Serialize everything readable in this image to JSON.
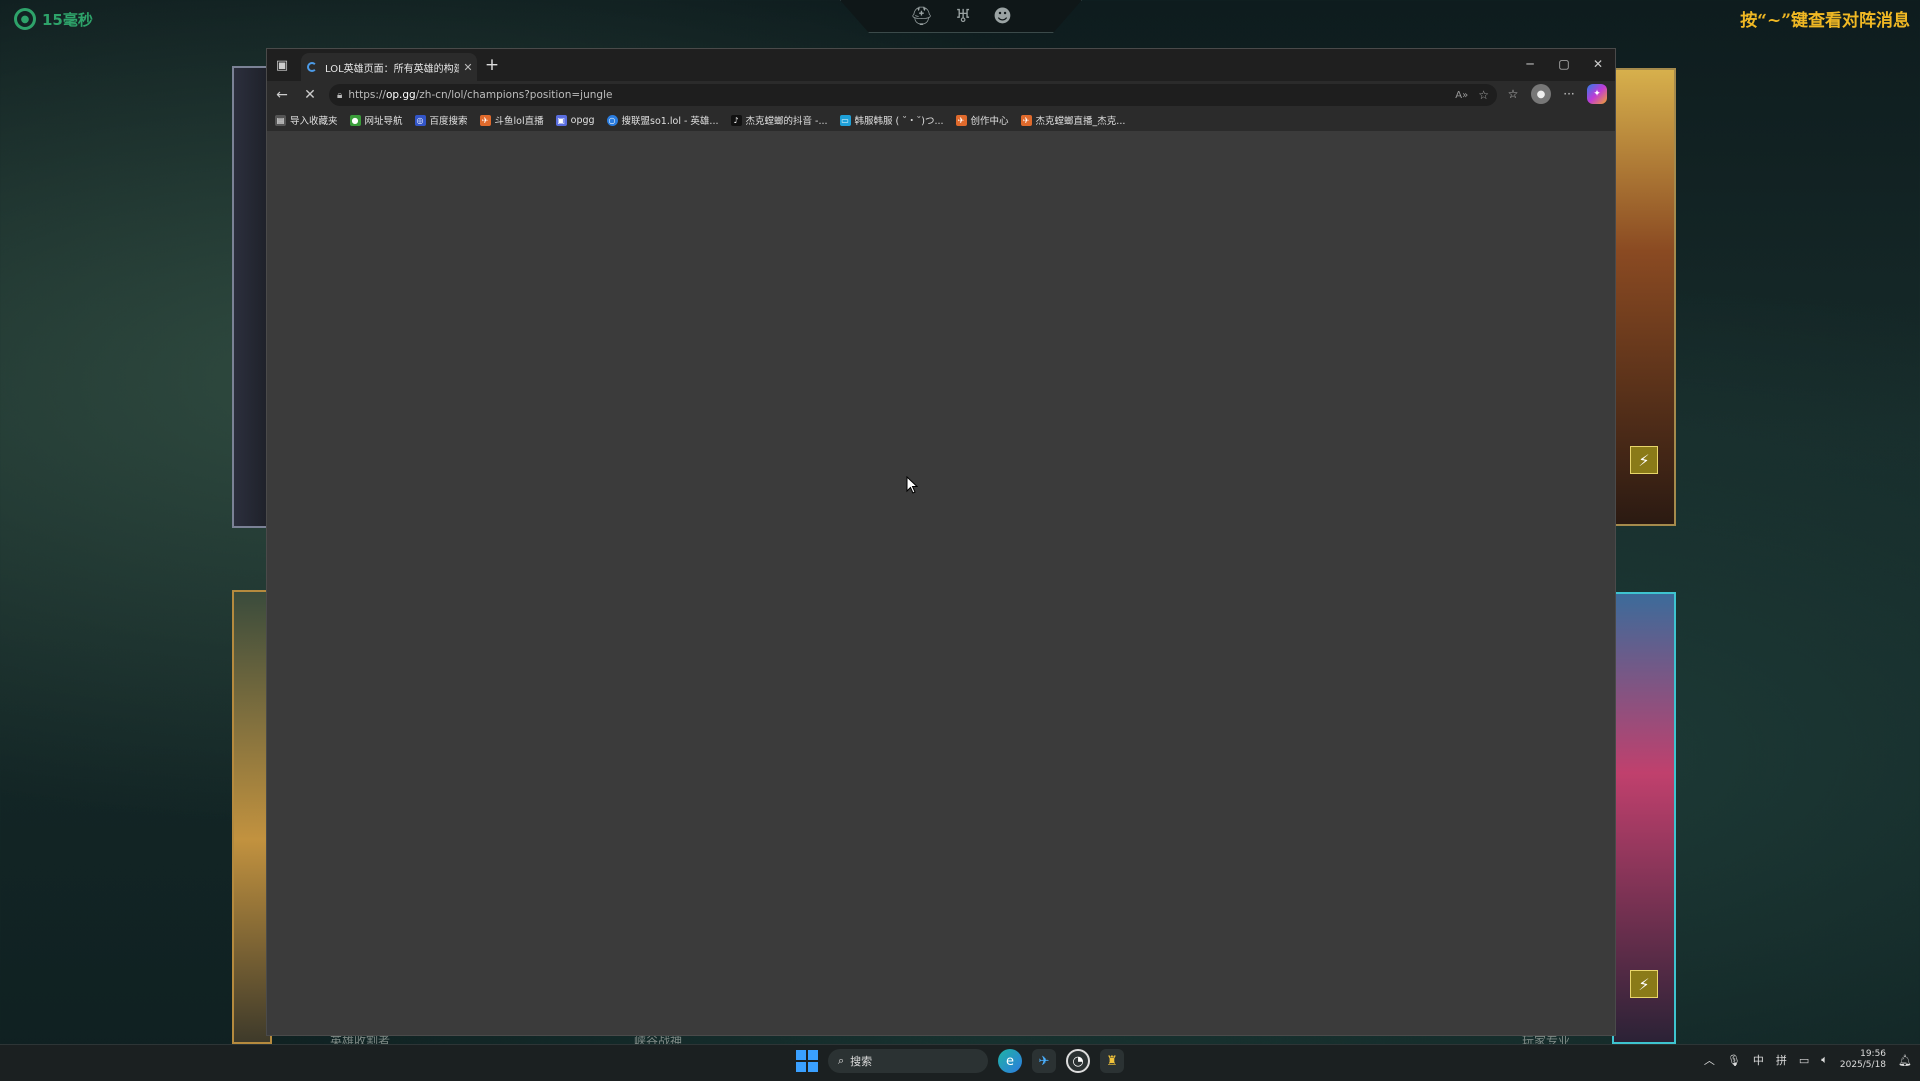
{
  "overlay": {
    "ping_text": "15毫秒",
    "hint_text": "按“~”键查看对阵消息",
    "bottom_labels": [
      "英雄收割者",
      "峡谷战神",
      "玩家专业"
    ]
  },
  "browser": {
    "tab_title": "LOL英雄页面：所有英雄的构建、",
    "tab_close": "✕",
    "new_tab": "+",
    "url_prefix": "https://",
    "url_host": "op.gg",
    "url_path": "/zh-cn/lol/champions?position=jungle",
    "bookmarks": [
      {
        "label": "导入收藏夹",
        "color": "#555"
      },
      {
        "label": "网址导航",
        "color": "#3a9d3a"
      },
      {
        "label": "百度搜索",
        "color": "#3255c8"
      },
      {
        "label": "斗鱼lol直播",
        "color": "#e06a2c"
      },
      {
        "label": "opgg",
        "color": "#5a6ee0"
      },
      {
        "label": "搜联盟so1.lol - 英雄...",
        "color": "#2a7de0"
      },
      {
        "label": "杰克螳螂的抖音 -...",
        "color": "#111"
      },
      {
        "label": "韩服韩服 ( ˘・˘)つ...",
        "color": "#1ea0d8"
      },
      {
        "label": "创作中心",
        "color": "#e06a2c"
      },
      {
        "label": "杰克螳螂直播_杰克...",
        "color": "#e06a2c"
      }
    ]
  },
  "taskbar": {
    "search_placeholder": "搜索",
    "ime_lang": "中",
    "ime_mode": "拼",
    "time": "19:56",
    "date": "2025/5/18"
  },
  "icons": [
    "back-icon",
    "stop-icon",
    "lock-icon",
    "star-icon",
    "favorites-icon",
    "more-icon"
  ],
  "colors": {
    "accent": "#3aa0ff",
    "ping": "#2ea36a",
    "hint": "#f0b824"
  }
}
